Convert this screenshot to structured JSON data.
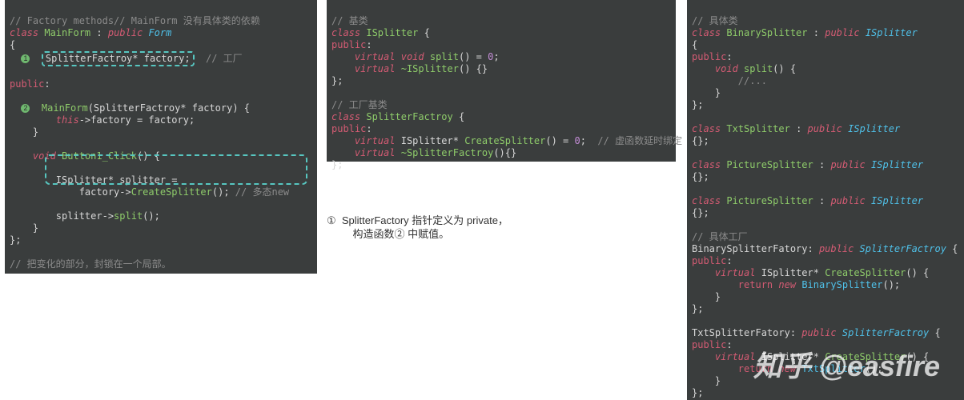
{
  "pane1": {
    "c0": "// Factory methods// MainForm 没有具体类的依赖",
    "l1a": "class",
    "l1b": "MainForm",
    "l1c": ":",
    "l1d": "public",
    "l1e": "Form",
    "l2": "{",
    "badge1": "1",
    "l3a": "SplitterFactroy* ",
    "l3b": "factory",
    "l3c": ";",
    "l3d": "// 工厂",
    "l5a": "public",
    "l5b": ":",
    "badge2": "2",
    "l6a": "MainForm",
    "l6b": "(SplitterFactroy* factory) {",
    "l7a": "this",
    "l7b": "->factory = factory;",
    "l8": "    }",
    "l9a": "void",
    "l9b": "Button1_Click",
    "l9c": "() {",
    "l10a": "ISplitter* splitter =",
    "l10b": "    factory->",
    "l10c": "CreateSplitter",
    "l10d": "();",
    "l10e": "// 多态new",
    "l11a": "        splitter->",
    "l11b": "split",
    "l11c": "();",
    "l12": "    }",
    "l13": "};",
    "c1": "// 把变化的部分，封锁在一个局部。"
  },
  "caption1a": "①  SplitterFactory 指针定义为 private，",
  "caption1b": "         构造函数② 中赋值。",
  "pane2": {
    "c0": "// 基类",
    "l1a": "class",
    "l1b": "ISplitter",
    "l1c": "{",
    "l2a": "public",
    "l2b": ":",
    "l3a": "virtual",
    "l3b": "void",
    "l3c": "split",
    "l3d": "() = ",
    "l3e": "0",
    "l3f": ";",
    "l4a": "virtual",
    "l4b": "~ISplitter",
    "l4c": "() {}",
    "l5": "};",
    "c1": "// 工厂基类",
    "l6a": "class",
    "l6b": "SplitterFactroy",
    "l6c": "{",
    "l7a": "public",
    "l7b": ":",
    "l8a": "virtual",
    "l8b": "ISplitter*",
    "l8c": "CreateSplitter",
    "l8d": "() = ",
    "l8e": "0",
    "l8f": ";",
    "l8g": "// 虚函数延时绑定",
    "l9a": "virtual",
    "l9b": "~SplitterFactroy",
    "l9c": "(){}",
    "l10": "};"
  },
  "pane3": {
    "c0": "// 具体类",
    "a1a": "class",
    "a1b": "BinarySplitter",
    "a1c": ":",
    "a1d": "public",
    "a1e": "ISplitter",
    "a2": "{",
    "a3a": "public",
    "a3b": ":",
    "a4a": "void",
    "a4b": "split",
    "a4c": "() {",
    "a5": "        //...",
    "a6": "    }",
    "a7": "};",
    "b1a": "class",
    "b1b": "TxtSplitter",
    "b1c": ":",
    "b1d": "public",
    "b1e": "ISplitter",
    "b2": "{};",
    "c1a": "class",
    "c1b": "PictureSplitter",
    "c1c": ":",
    "c1d": "public",
    "c1e": "ISplitter",
    "c2": "{};",
    "d1a": "class",
    "d1b": "PictureSplitter",
    "d1c": ":",
    "d1d": "public",
    "d1e": "ISplitter",
    "d2": "{};",
    "cm1": "// 具体工厂",
    "e1a": "BinarySplitterFatory:",
    "e1b": "public",
    "e1c": "SplitterFactroy",
    "e1d": "{",
    "e2a": "public",
    "e2b": ":",
    "e3a": "virtual",
    "e3b": "ISplitter*",
    "e3c": "CreateSplitter",
    "e3d": "() {",
    "e4a": "return",
    "e4b": "new",
    "e4c": "BinarySplitter",
    "e4d": "();",
    "e5": "    }",
    "e6": "};",
    "f1a": "TxtSplitterFatory:",
    "f1b": "public",
    "f1c": "SplitterFactroy",
    "f1d": "{",
    "f2a": "public",
    "f2b": ":",
    "f3a": "virtual",
    "f3b": "ISplitter*",
    "f3c": "CreateSplitter",
    "f3d": "() {",
    "f4a": "return",
    "f4b": "new",
    "f4c": "TxtSplitter",
    "f4d": "();",
    "f5": "    }",
    "f6": "};"
  },
  "watermark": "知乎 @easfire"
}
